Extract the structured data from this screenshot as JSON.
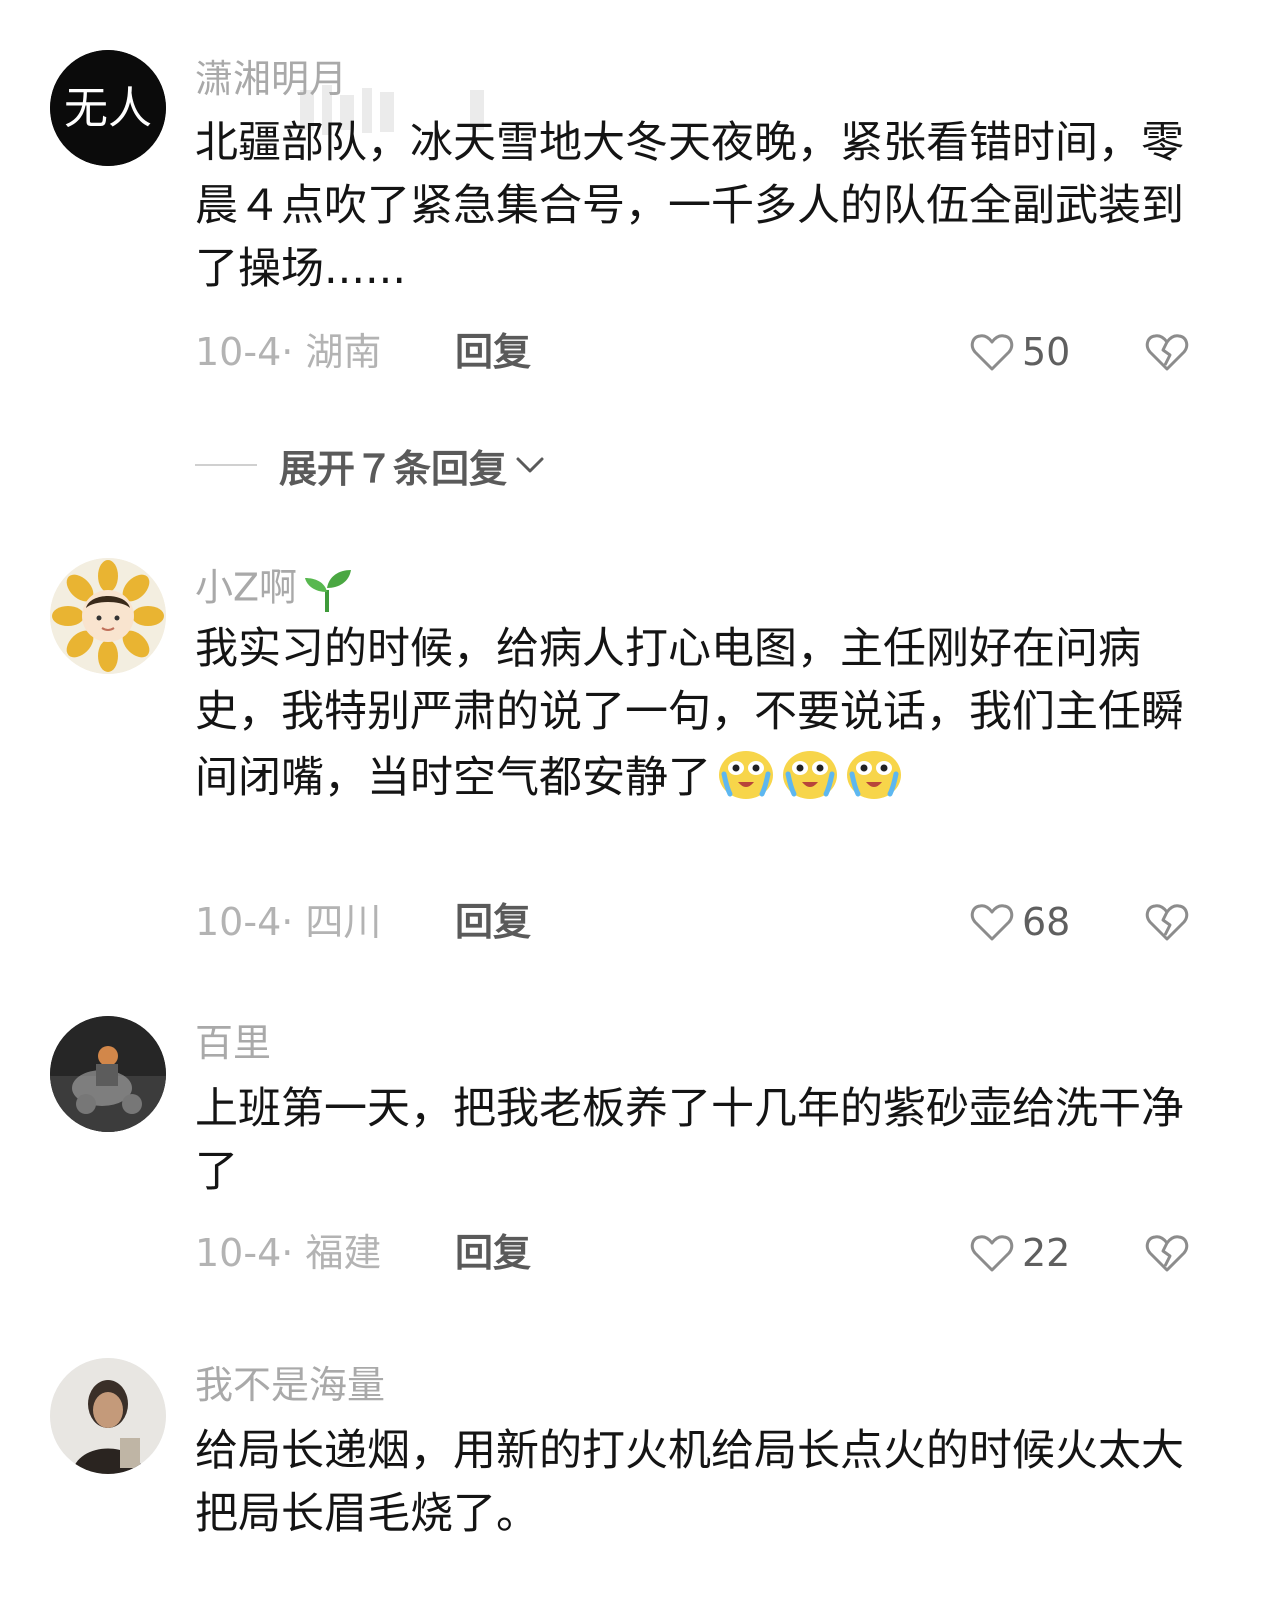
{
  "comments": [
    {
      "username": "潇湘明月",
      "avatar_text": "无人",
      "text": "北疆部队，冰天雪地大冬天夜晚，紧张看错时间，零晨４点吹了紧急集合号，一千多人的队伍全副武装到了操场......",
      "date_location": "10-4· 湖南",
      "reply_label": "回复",
      "likes": "50"
    },
    {
      "username": "小Z啊",
      "username_emoji": "seedling-icon",
      "text": "我实习的时候，给病人打心电图，主任刚好在问病史，我特别严肃的说了一句，不要说话，我们主任瞬间闭嘴，当时空气都安静了",
      "inline_emojis": [
        "laugh-cry-icon",
        "laugh-cry-icon",
        "laugh-cry-icon"
      ],
      "date_location": "10-4· 四川",
      "reply_label": "回复",
      "likes": "68"
    },
    {
      "username": "百里",
      "text": "上班第一天，把我老板养了十几年的紫砂壶给洗干净了",
      "date_location": "10-4· 福建",
      "reply_label": "回复",
      "likes": "22"
    },
    {
      "username": "我不是海量",
      "text": "给局长递烟，用新的打火机给局长点火的时候火太大把局长眉毛烧了。"
    }
  ],
  "expand_replies": {
    "label": "展开７条回复"
  },
  "icons": {
    "like": "heart-outline-icon",
    "dislike": "broken-heart-icon",
    "expand": "chevron-down-icon"
  },
  "colors": {
    "username": "#a9a9a9",
    "body_text": "#141414",
    "meta": "#b3b3b3",
    "action": "#5a5a5a"
  }
}
